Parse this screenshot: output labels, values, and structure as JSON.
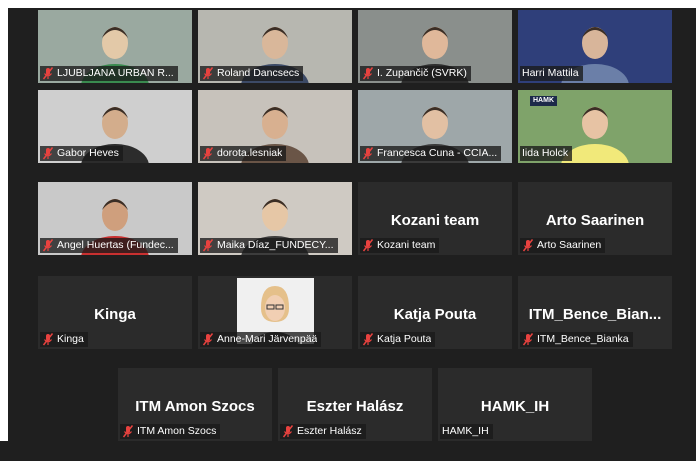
{
  "participants": [
    {
      "name": "LJUBLJANA URBAN R...",
      "type": "video",
      "muted": true
    },
    {
      "name": "Roland Dancsecs",
      "type": "video",
      "muted": true
    },
    {
      "name": "I. Zupančič (SVRK)",
      "type": "video",
      "muted": true
    },
    {
      "name": "Harri Mattila",
      "type": "video",
      "muted": false
    },
    {
      "name": "Gabor Heves",
      "type": "video",
      "muted": true
    },
    {
      "name": "dorota.lesniak",
      "type": "video",
      "muted": true
    },
    {
      "name": "Francesca Cuna - CCIA...",
      "type": "video",
      "muted": true
    },
    {
      "name": "Iida Holck",
      "type": "video",
      "muted": false,
      "speaking": true,
      "overlay_logo": "HAMK"
    },
    {
      "name": "Angel Huertas (Fundec...",
      "type": "video",
      "muted": true
    },
    {
      "name": "Maika Díaz_FUNDECY...",
      "type": "video",
      "muted": true
    },
    {
      "name": "Kozani team",
      "display_name": "Kozani team",
      "type": "name",
      "muted": true
    },
    {
      "name": "Arto Saarinen",
      "display_name": "Arto Saarinen",
      "type": "name",
      "muted": true
    },
    {
      "name": "Kinga",
      "display_name": "Kinga",
      "type": "name",
      "muted": true
    },
    {
      "name": "Anne-Mari Järvenpää",
      "type": "photo",
      "muted": true
    },
    {
      "name": "Katja Pouta",
      "display_name": "Katja Pouta",
      "type": "name",
      "muted": true
    },
    {
      "name": "ITM_Bence_Bianka",
      "display_name": "ITM_Bence_Bian...",
      "type": "name",
      "muted": true
    },
    {
      "name": "ITM Amon Szocs",
      "display_name": "ITM Amon Szocs",
      "type": "name",
      "muted": true
    },
    {
      "name": "Eszter Halász",
      "display_name": "Eszter Halász",
      "type": "name",
      "muted": true
    },
    {
      "name": "HAMK_IH",
      "display_name": "HAMK_IH",
      "type": "name",
      "muted": false
    }
  ],
  "colors": {
    "stage_bg": "#1f1f1f",
    "tile_bg": "#2b2b2b",
    "speaking_border": "#d7e85e",
    "muted_icon": "#e8423f"
  },
  "icons": {
    "muted": "mic-off-icon"
  }
}
